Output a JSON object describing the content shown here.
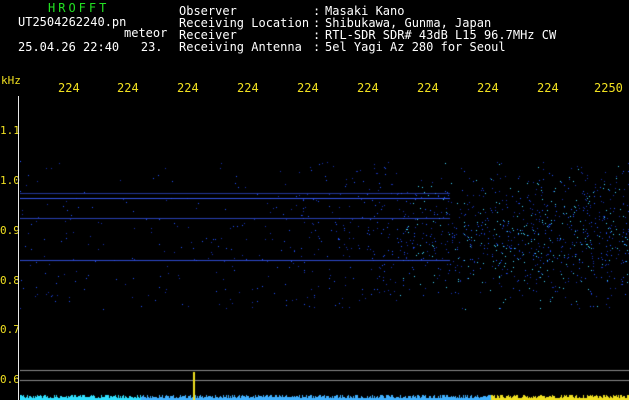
{
  "header": {
    "logo": "HROFFT",
    "filename": "UT2504262240.pn",
    "meteor": "meteor",
    "datetime": "25.04.26 22:40",
    "count": "23.",
    "fields": [
      {
        "label": "Observer",
        "value": "Masaki Kano"
      },
      {
        "label": "Receiving Location",
        "value": "Shibukawa, Gunma, Japan"
      },
      {
        "label": "Receiver",
        "value": "RTL-SDR SDR# 43dB L15 96.7MHz CW"
      },
      {
        "label": "Receiving Antenna",
        "value": "5el Yagi Az 280 for Seoul"
      }
    ]
  },
  "axis": {
    "unit": "kHz",
    "x_ticks": [
      "224",
      "224",
      "224",
      "224",
      "224",
      "224",
      "224",
      "224",
      "224",
      "2250"
    ],
    "y_ticks": [
      "1.1",
      "1.0",
      "0.9",
      "0.8",
      "0.7",
      "0.6"
    ]
  },
  "colors": {
    "background": "#000000",
    "text_white": "#ffffff",
    "text_green": "#22e022",
    "text_yellow": "#f0e020",
    "noise_blue": "#2040ff",
    "noise_cyan": "#30e0ff",
    "level_yellow": "#f0e020"
  }
}
